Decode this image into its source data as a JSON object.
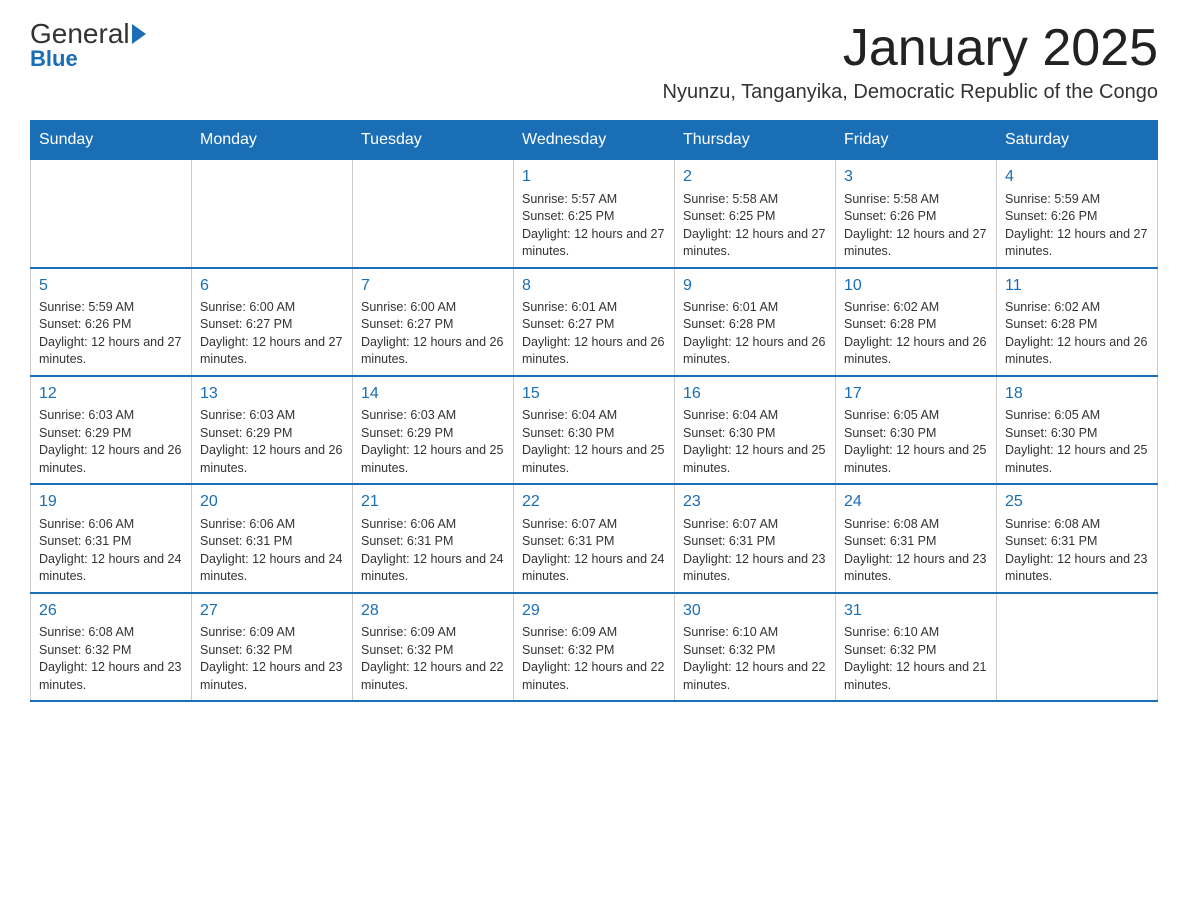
{
  "logo": {
    "general": "General",
    "blue": "Blue"
  },
  "title": "January 2025",
  "subtitle": "Nyunzu, Tanganyika, Democratic Republic of the Congo",
  "days_of_week": [
    "Sunday",
    "Monday",
    "Tuesday",
    "Wednesday",
    "Thursday",
    "Friday",
    "Saturday"
  ],
  "weeks": [
    [
      {
        "day": "",
        "info": ""
      },
      {
        "day": "",
        "info": ""
      },
      {
        "day": "",
        "info": ""
      },
      {
        "day": "1",
        "info": "Sunrise: 5:57 AM\nSunset: 6:25 PM\nDaylight: 12 hours and 27 minutes."
      },
      {
        "day": "2",
        "info": "Sunrise: 5:58 AM\nSunset: 6:25 PM\nDaylight: 12 hours and 27 minutes."
      },
      {
        "day": "3",
        "info": "Sunrise: 5:58 AM\nSunset: 6:26 PM\nDaylight: 12 hours and 27 minutes."
      },
      {
        "day": "4",
        "info": "Sunrise: 5:59 AM\nSunset: 6:26 PM\nDaylight: 12 hours and 27 minutes."
      }
    ],
    [
      {
        "day": "5",
        "info": "Sunrise: 5:59 AM\nSunset: 6:26 PM\nDaylight: 12 hours and 27 minutes."
      },
      {
        "day": "6",
        "info": "Sunrise: 6:00 AM\nSunset: 6:27 PM\nDaylight: 12 hours and 27 minutes."
      },
      {
        "day": "7",
        "info": "Sunrise: 6:00 AM\nSunset: 6:27 PM\nDaylight: 12 hours and 26 minutes."
      },
      {
        "day": "8",
        "info": "Sunrise: 6:01 AM\nSunset: 6:27 PM\nDaylight: 12 hours and 26 minutes."
      },
      {
        "day": "9",
        "info": "Sunrise: 6:01 AM\nSunset: 6:28 PM\nDaylight: 12 hours and 26 minutes."
      },
      {
        "day": "10",
        "info": "Sunrise: 6:02 AM\nSunset: 6:28 PM\nDaylight: 12 hours and 26 minutes."
      },
      {
        "day": "11",
        "info": "Sunrise: 6:02 AM\nSunset: 6:28 PM\nDaylight: 12 hours and 26 minutes."
      }
    ],
    [
      {
        "day": "12",
        "info": "Sunrise: 6:03 AM\nSunset: 6:29 PM\nDaylight: 12 hours and 26 minutes."
      },
      {
        "day": "13",
        "info": "Sunrise: 6:03 AM\nSunset: 6:29 PM\nDaylight: 12 hours and 26 minutes."
      },
      {
        "day": "14",
        "info": "Sunrise: 6:03 AM\nSunset: 6:29 PM\nDaylight: 12 hours and 25 minutes."
      },
      {
        "day": "15",
        "info": "Sunrise: 6:04 AM\nSunset: 6:30 PM\nDaylight: 12 hours and 25 minutes."
      },
      {
        "day": "16",
        "info": "Sunrise: 6:04 AM\nSunset: 6:30 PM\nDaylight: 12 hours and 25 minutes."
      },
      {
        "day": "17",
        "info": "Sunrise: 6:05 AM\nSunset: 6:30 PM\nDaylight: 12 hours and 25 minutes."
      },
      {
        "day": "18",
        "info": "Sunrise: 6:05 AM\nSunset: 6:30 PM\nDaylight: 12 hours and 25 minutes."
      }
    ],
    [
      {
        "day": "19",
        "info": "Sunrise: 6:06 AM\nSunset: 6:31 PM\nDaylight: 12 hours and 24 minutes."
      },
      {
        "day": "20",
        "info": "Sunrise: 6:06 AM\nSunset: 6:31 PM\nDaylight: 12 hours and 24 minutes."
      },
      {
        "day": "21",
        "info": "Sunrise: 6:06 AM\nSunset: 6:31 PM\nDaylight: 12 hours and 24 minutes."
      },
      {
        "day": "22",
        "info": "Sunrise: 6:07 AM\nSunset: 6:31 PM\nDaylight: 12 hours and 24 minutes."
      },
      {
        "day": "23",
        "info": "Sunrise: 6:07 AM\nSunset: 6:31 PM\nDaylight: 12 hours and 23 minutes."
      },
      {
        "day": "24",
        "info": "Sunrise: 6:08 AM\nSunset: 6:31 PM\nDaylight: 12 hours and 23 minutes."
      },
      {
        "day": "25",
        "info": "Sunrise: 6:08 AM\nSunset: 6:31 PM\nDaylight: 12 hours and 23 minutes."
      }
    ],
    [
      {
        "day": "26",
        "info": "Sunrise: 6:08 AM\nSunset: 6:32 PM\nDaylight: 12 hours and 23 minutes."
      },
      {
        "day": "27",
        "info": "Sunrise: 6:09 AM\nSunset: 6:32 PM\nDaylight: 12 hours and 23 minutes."
      },
      {
        "day": "28",
        "info": "Sunrise: 6:09 AM\nSunset: 6:32 PM\nDaylight: 12 hours and 22 minutes."
      },
      {
        "day": "29",
        "info": "Sunrise: 6:09 AM\nSunset: 6:32 PM\nDaylight: 12 hours and 22 minutes."
      },
      {
        "day": "30",
        "info": "Sunrise: 6:10 AM\nSunset: 6:32 PM\nDaylight: 12 hours and 22 minutes."
      },
      {
        "day": "31",
        "info": "Sunrise: 6:10 AM\nSunset: 6:32 PM\nDaylight: 12 hours and 21 minutes."
      },
      {
        "day": "",
        "info": ""
      }
    ]
  ]
}
